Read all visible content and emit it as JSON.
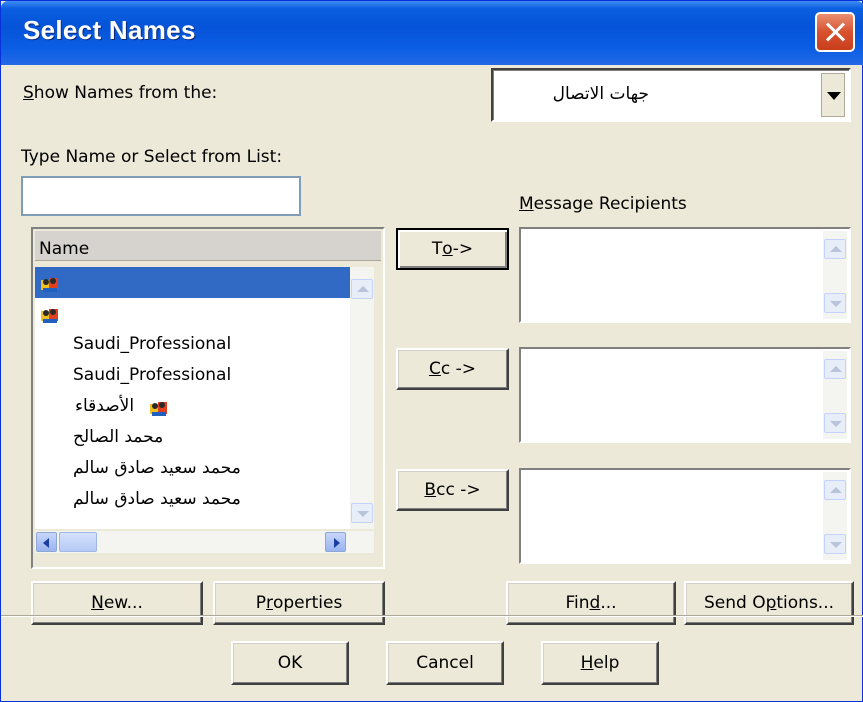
{
  "window": {
    "title": "Select Names"
  },
  "show_names": {
    "label_accel": "S",
    "label_rest": "how Names from the:",
    "selected": "جهات الاتصال"
  },
  "type_name": {
    "label": "Type Name or Select from List:",
    "value": ""
  },
  "name_list": {
    "header": "Name",
    "items": [
      {
        "label": "",
        "icon": "distribution-list-icon",
        "selected": true
      },
      {
        "label": "",
        "icon": "distribution-list-icon",
        "selected": false
      },
      {
        "label": "Saudi_Professional",
        "icon": "",
        "selected": false
      },
      {
        "label": "Saudi_Professional",
        "icon": "",
        "selected": false
      },
      {
        "label": "الأصدقاء",
        "icon": "distribution-list-icon",
        "selected": false
      },
      {
        "label": "محمد الصالح",
        "icon": "",
        "selected": false
      },
      {
        "label": "محمد سعيد صادق سالم",
        "icon": "",
        "selected": false
      },
      {
        "label": "محمد سعيد صادق سالم",
        "icon": "",
        "selected": false
      }
    ]
  },
  "recipients": {
    "label_accel": "M",
    "label_rest": "essage Recipients",
    "to": {
      "pre": "T",
      "accel": "o",
      "post": " ->"
    },
    "cc": {
      "pre": "",
      "accel": "C",
      "post": "c ->"
    },
    "bcc": {
      "pre": "",
      "accel": "B",
      "post": "cc ->"
    }
  },
  "buttons": {
    "new": {
      "pre": "",
      "accel": "N",
      "post": "ew..."
    },
    "properties": {
      "pre": "P",
      "accel": "r",
      "post": "operties"
    },
    "find": {
      "pre": "Fin",
      "accel": "d",
      "post": "..."
    },
    "send_options": {
      "pre": "Send O",
      "accel": "p",
      "post": "tions..."
    },
    "ok": "OK",
    "cancel": "Cancel",
    "help": {
      "pre": "",
      "accel": "H",
      "post": "elp"
    }
  },
  "colors": {
    "selection": "#316ac5",
    "titlebar": "#0553d8",
    "close": "#d8512f"
  }
}
